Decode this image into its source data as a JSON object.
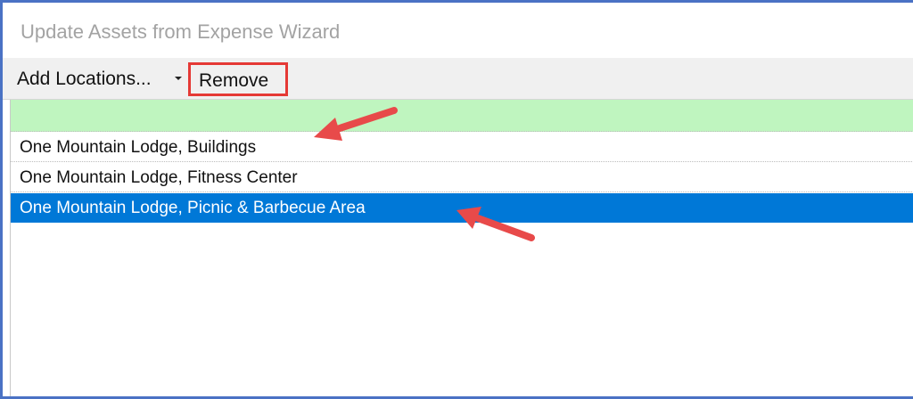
{
  "window": {
    "title": "Update Assets from Expense Wizard"
  },
  "toolbar": {
    "add_label": "Add Locations...",
    "remove_label": "Remove"
  },
  "list": {
    "new_row_label": "",
    "items": [
      {
        "label": "One Mountain Lodge, Buildings",
        "selected": false
      },
      {
        "label": "One Mountain Lodge, Fitness Center",
        "selected": false
      },
      {
        "label": "One Mountain Lodge, Picnic & Barbecue Area",
        "selected": true
      }
    ]
  },
  "colors": {
    "title_text": "#a3a3a3",
    "toolbar_bg": "#f0f0f0",
    "highlight_box": "#e53935",
    "new_row_bg": "#bff5bf",
    "selected_bg": "#0078d7",
    "annotation_arrow": "#e84a4a",
    "window_border": "#4a72c4"
  },
  "annotations": {
    "arrows": [
      "arrow-to-new-row",
      "arrow-to-selected-row"
    ]
  }
}
